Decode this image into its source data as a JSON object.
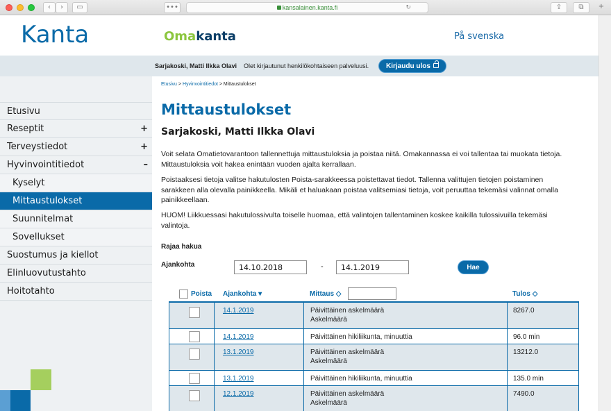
{
  "browser": {
    "url": "kansalainen.kanta.fi",
    "tab_button": "•••"
  },
  "header": {
    "logo": "Kanta",
    "service_oma": "Oma",
    "service_kanta": "kanta",
    "language_link": "På svenska"
  },
  "userbar": {
    "name": "Sarjakoski, Matti Ilkka Olavi",
    "status": "Olet kirjautunut henkilökohtaiseen palveluusi.",
    "logout_label": "Kirjaudu ulos"
  },
  "sidebar": {
    "items": [
      {
        "label": "Etusivu",
        "expand": ""
      },
      {
        "label": "Reseptit",
        "expand": "+"
      },
      {
        "label": "Terveystiedot",
        "expand": "+"
      },
      {
        "label": "Hyvinvointitiedot",
        "expand": "–"
      },
      {
        "label": "Kyselyt",
        "expand": ""
      },
      {
        "label": "Mittaustulokset",
        "expand": ""
      },
      {
        "label": "Suunnitelmat",
        "expand": ""
      },
      {
        "label": "Sovellukset",
        "expand": ""
      },
      {
        "label": "Suostumus ja kiellot",
        "expand": ""
      },
      {
        "label": "Elinluovutustahto",
        "expand": ""
      },
      {
        "label": "Hoitotahto",
        "expand": ""
      }
    ]
  },
  "breadcrumb": {
    "home": "Etusivu",
    "sep1": " > ",
    "section": "Hyvinvointitiedot",
    "sep2": " > ",
    "current": "Mittaustulokset"
  },
  "main": {
    "title": "Mittaustulokset",
    "person": "Sarjakoski, Matti Ilkka Olavi",
    "p1": "Voit selata Omatietovarantoon tallennettuja mittaustuloksia ja poistaa niitä. Omakannassa ei voi tallentaa tai muokata tietoja. Mittaustuloksia voit hakea enintään vuoden ajalta kerrallaan.",
    "p2": "Poistaaksesi tietoja valitse hakutulosten Poista-sarakkeessa poistettavat tiedot. Tallenna valittujen tietojen poistaminen sarakkeen alla olevalla painikkeella. Mikäli et haluakaan poistaa valitsemiasi tietoja, voit peruuttaa tekemäsi valinnat omalla painikkeellaan.",
    "p3": "HUOM! Liikkuessasi hakutulossivulta toiselle huomaa, että valintojen tallentaminen koskee kaikilla tulossivuilla tekemäsi valintoja.",
    "filter_title": "Rajaa hakua",
    "date_label": "Ajankohta",
    "date_from": "14.10.2018",
    "date_sep": "-",
    "date_to": "14.1.2019",
    "search_button": "Hae"
  },
  "table": {
    "headers": {
      "delete": "Poista",
      "date": "Ajankohta ▾",
      "measurement": "Mittaus ◇",
      "result": "Tulos ◇"
    },
    "rows": [
      {
        "date": "14.1.2019",
        "measurement": "Päivittäinen askelmäärä",
        "sub": "Askelmäärä",
        "result": "8267.0"
      },
      {
        "date": "14.1.2019",
        "measurement": "Päivittäinen hikiliikunta, minuuttia",
        "sub": "",
        "result": "96.0 min"
      },
      {
        "date": "13.1.2019",
        "measurement": "Päivittäinen askelmäärä",
        "sub": "Askelmäärä",
        "result": "13212.0"
      },
      {
        "date": "13.1.2019",
        "measurement": "Päivittäinen hikiliikunta, minuuttia",
        "sub": "",
        "result": "135.0 min"
      },
      {
        "date": "12.1.2019",
        "measurement": "Päivittäinen askelmäärä",
        "sub": "Askelmäärä",
        "result": "7490.0"
      }
    ]
  }
}
